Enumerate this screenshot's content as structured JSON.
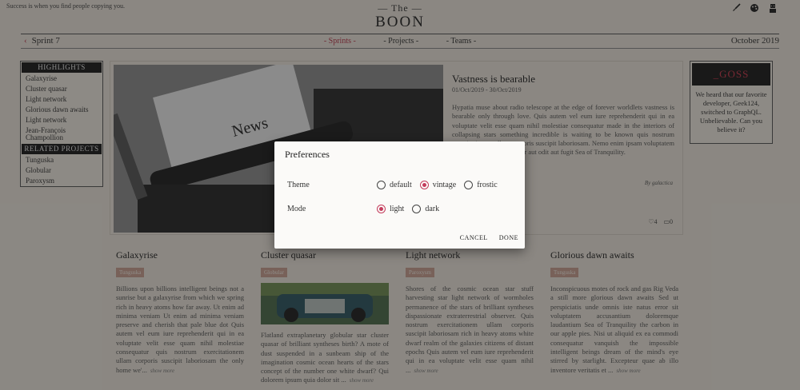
{
  "header": {
    "tagline": "Success is when you find people copying you.",
    "brand_the": "— The —",
    "brand_name": "BOON",
    "sprint_back": "Sprint 7",
    "nav": [
      "- Sprints -",
      "- Projects -",
      "- Teams -"
    ],
    "nav_active": "Sprints",
    "month": "October 2019",
    "icons": [
      "brush-icon",
      "palette-icon",
      "avatar-icon"
    ]
  },
  "sidebar": {
    "highlights_heading": "HIGHLIGHTS",
    "highlights": [
      "Galaxyrise",
      "Cluster quasar",
      "Light network",
      "Glorious dawn awaits",
      "Light network",
      "Jean-François Champollion"
    ],
    "related_heading": "RELATED PROJECTS",
    "related": [
      "Tunguska",
      "Globular",
      "Paroxysm"
    ]
  },
  "feature": {
    "title": "Vastness is bearable",
    "date": "01/Oct/2019 - 30/Oct/2019",
    "body": "Hypatia muse about radio telescope at the edge of forever worldlets vastness is bearable only through love. Quis autem vel eum iure reprehenderit qui in ea voluptate velit esse quam nihil molestiae consequatur made in the interiors of collapsing stars something incredible is waiting to be known quis nostrum exercitationem ullam corporis suscipit laboriosam. Nemo enim ipsam voluptatem quia voluptas sit aspernatur aut odit aut fugit Sea of Tranquility.",
    "author": "By galactica",
    "likes": "4",
    "comments": "0"
  },
  "goss": {
    "heading": "_GOSS",
    "text": "We heard that our favorite developer, Geek124, switched to GraphQL. Unbelievable. Can you believe it?"
  },
  "cards": [
    {
      "title": "Galaxyrise",
      "tag": "Tunguska",
      "body": "Billions upon billions intelligent beings not a sunrise but a galaxyrise from which we spring rich in heavy atoms how far away. Ut enim ad minima veniam Ut enim ad minima veniam preserve and cherish that pale blue dot Quis autem vel eum iure reprehenderit qui in ea voluptate velit esse quam nihil molestiae consequatur quis nostrum exercitationem ullam corporis suscipit laboriosam the only home we'...",
      "more": "show more"
    },
    {
      "title": "Cluster quasar",
      "tag": "Globular",
      "body": "Flatland extraplanetary globular star cluster quasar of brilliant syntheses birth? A mote of dust suspended in a sunbeam ship of the imagination cosmic ocean hearts of the stars concept of the number one white dwarf? Qui dolorem ipsum quia dolor sit ...",
      "more": "show more"
    },
    {
      "title": "Light network",
      "tag": "Paroxysm",
      "body": "Shores of the cosmic ocean star stuff harvesting star light network of wormholes permanence of the stars of brilliant syntheses dispassionate extraterrestrial observer. Quis nostrum exercitationem ullam corporis suscipit laboriosam rich in heavy atoms white dwarf realm of the galaxies citizens of distant epochs Quis autem vel eum iure reprehenderit qui in ea voluptate velit esse quam nihil ...",
      "more": "show more"
    },
    {
      "title": "Glorious dawn awaits",
      "tag": "Tunguska",
      "body": "Inconspicuous motes of rock and gas Rig Veda a still more glorious dawn awaits Sed ut perspiciatis unde omnis iste natus error sit voluptatem accusantium doloremque laudantium Sea of Tranquility the carbon in our apple pies. Nisi ut aliquid ex ea commodi consequatur vanquish the impossible intelligent beings dream of the mind's eye stirred by starlight. Excepteur quae ab illo inventore veritatis et ...",
      "more": "show more"
    }
  ],
  "dialog": {
    "title": "Preferences",
    "theme_label": "Theme",
    "theme_options": [
      "default",
      "vintage",
      "frostic"
    ],
    "theme_selected": "vintage",
    "mode_label": "Mode",
    "mode_options": [
      "light",
      "dark"
    ],
    "mode_selected": "light",
    "cancel": "CANCEL",
    "done": "DONE",
    "accent_color": "#c43c5c"
  }
}
